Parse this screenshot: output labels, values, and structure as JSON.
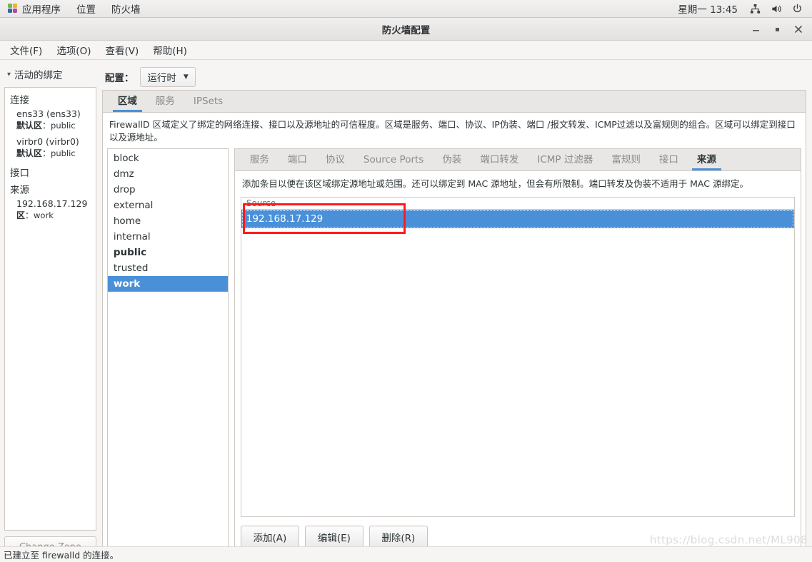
{
  "desktop_panel": {
    "logo_icon": "gnome-logo-icon",
    "items": [
      "应用程序",
      "位置",
      "防火墙"
    ],
    "clock": "星期一 13:45",
    "tray_icons": [
      "network-icon",
      "volume-icon",
      "power-icon"
    ]
  },
  "window": {
    "title": "防火墙配置",
    "controls": {
      "minimize": "minimize-icon",
      "maximize": "maximize-icon",
      "close": "close-icon"
    },
    "menus": [
      "文件(F)",
      "选项(O)",
      "查看(V)",
      "帮助(H)"
    ]
  },
  "left_pane": {
    "header": "活动的绑定",
    "chevron": "chevron-down-icon",
    "groups": [
      {
        "title": "连接",
        "entries": [
          {
            "name": "ens33 (ens33)",
            "default_label": "默认区",
            "default_value": "public"
          },
          {
            "name": "virbr0 (virbr0)",
            "default_label": "默认区",
            "default_value": "public"
          }
        ]
      },
      {
        "title": "接口",
        "entries": []
      },
      {
        "title": "来源",
        "entries": [
          {
            "name": "192.168.17.129",
            "default_label": "区",
            "default_value": "work"
          }
        ]
      }
    ],
    "change_zone_button": "Change Zone"
  },
  "config_row": {
    "label": "配置：",
    "selected": "运行时",
    "dropdown_icon": "chevron-down-icon"
  },
  "outer_tabs": [
    {
      "label": "区域",
      "active": true
    },
    {
      "label": "服务",
      "active": false
    },
    {
      "label": "IPSets",
      "active": false
    }
  ],
  "outer_description": "FirewallD 区域定义了绑定的网络连接、接口以及源地址的可信程度。区域是服务、端口、协议、IP伪装、端口 /报文转发、ICMP过滤以及富规则的组合。区域可以绑定到接口以及源地址。",
  "zones": [
    {
      "name": "block",
      "style": "normal"
    },
    {
      "name": "dmz",
      "style": "normal"
    },
    {
      "name": "drop",
      "style": "normal"
    },
    {
      "name": "external",
      "style": "normal"
    },
    {
      "name": "home",
      "style": "normal"
    },
    {
      "name": "internal",
      "style": "normal"
    },
    {
      "name": "public",
      "style": "bold"
    },
    {
      "name": "trusted",
      "style": "normal"
    },
    {
      "name": "work",
      "style": "selected"
    }
  ],
  "inner_tabs": [
    {
      "label": "服务",
      "active": false
    },
    {
      "label": "端口",
      "active": false
    },
    {
      "label": "协议",
      "active": false
    },
    {
      "label": "Source Ports",
      "active": false
    },
    {
      "label": "伪装",
      "active": false
    },
    {
      "label": "端口转发",
      "active": false
    },
    {
      "label": "ICMP 过滤器",
      "active": false
    },
    {
      "label": "富规则",
      "active": false
    },
    {
      "label": "接口",
      "active": false
    },
    {
      "label": "来源",
      "active": true
    }
  ],
  "inner_description": "添加条目以便在该区域绑定源地址或范围。还可以绑定到 MAC 源地址，但会有所限制。端口转发及伪装不适用于 MAC 源绑定。",
  "source_table": {
    "column_header": "Source",
    "rows": [
      {
        "value": "192.168.17.129",
        "selected": true
      }
    ]
  },
  "action_buttons": [
    {
      "label": "添加(A)"
    },
    {
      "label": "编辑(E)"
    },
    {
      "label": "删除(R)"
    }
  ],
  "statusbar": {
    "text": "已建立至 firewalld 的连接。"
  },
  "watermark": {
    "text": "https://blog.csdn.net/ML908"
  },
  "colors": {
    "selection_blue": "#4a90d9",
    "annotation_red": "#ff1a1a",
    "window_bg": "#f6f5f4",
    "border": "#cdc7c2"
  }
}
